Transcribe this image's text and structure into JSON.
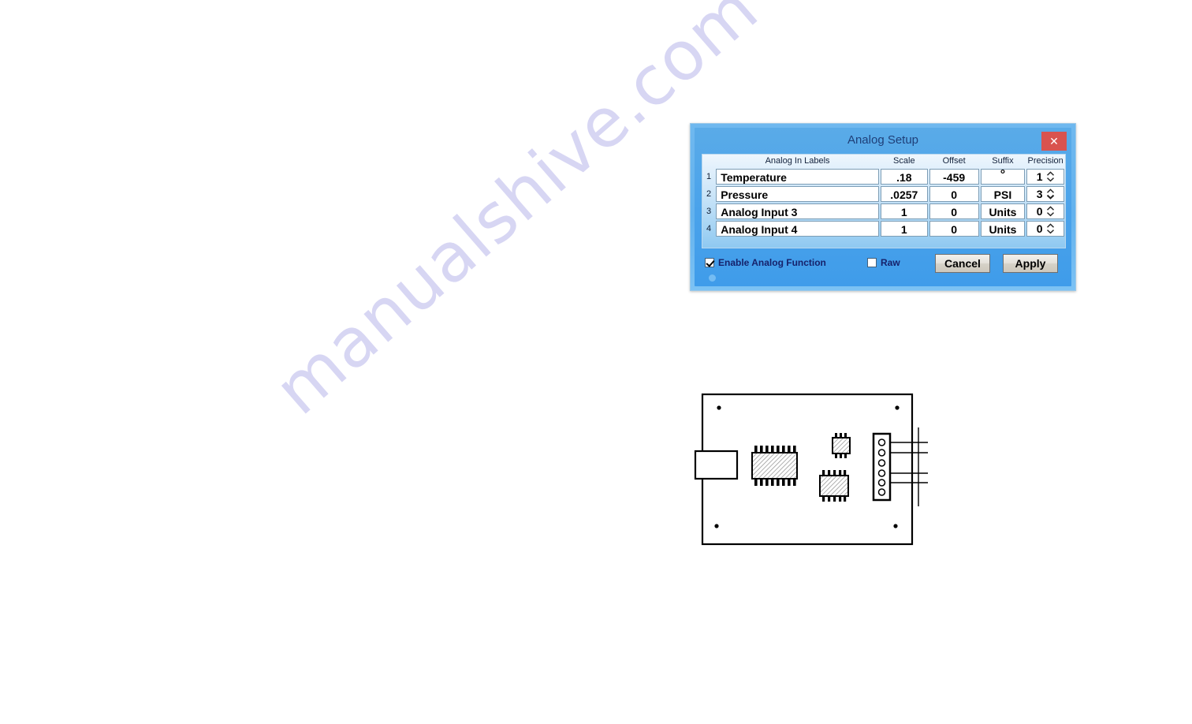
{
  "watermark": {
    "text": "manualshive.com"
  },
  "dialog": {
    "title": "Analog Setup",
    "close_label": "✕",
    "close_icon": "close-icon",
    "accent_color": "#4da4ea",
    "close_color": "#d9534f",
    "title_color": "#1f3f78",
    "headers": {
      "labels": "Analog In Labels",
      "scale": "Scale",
      "offset": "Offset",
      "suffix": "Suffix",
      "precision": "Precision"
    },
    "rows": [
      {
        "num": "1",
        "label": "Temperature",
        "scale": ".18",
        "offset": "-459",
        "suffix": "°",
        "precision": "1"
      },
      {
        "num": "2",
        "label": "Pressure",
        "scale": ".0257",
        "offset": "0",
        "suffix": "PSI",
        "precision": "3"
      },
      {
        "num": "3",
        "label": "Analog Input  3",
        "scale": "1",
        "offset": "0",
        "suffix": "Units",
        "precision": "0"
      },
      {
        "num": "4",
        "label": "Analog Input  4",
        "scale": "1",
        "offset": "0",
        "suffix": "Units",
        "precision": "0"
      }
    ],
    "checkboxes": {
      "enable": {
        "label": "Enable Analog Function",
        "checked": true
      },
      "raw": {
        "label": "Raw",
        "checked": false
      }
    },
    "buttons": {
      "cancel": "Cancel",
      "apply": "Apply"
    }
  },
  "pcb": {
    "description": "circuit board outline drawing",
    "mounting_holes": 4,
    "header_pins": 6,
    "wire_count": 4,
    "components": [
      "edge-connector",
      "large-ic",
      "small-ic",
      "medium-ic",
      "pin-header"
    ]
  }
}
